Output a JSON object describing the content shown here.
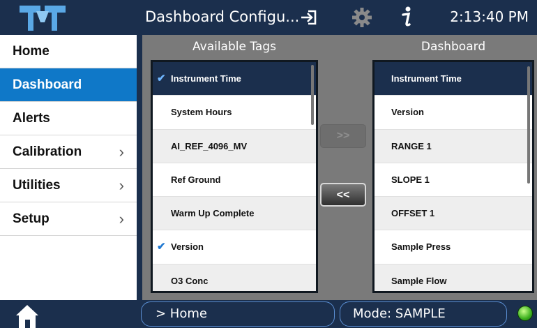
{
  "header": {
    "title": "Dashboard Configu...",
    "clock": "2:13:40 PM",
    "icons": {
      "logo": "teledyne-logo-icon",
      "exit": "exit-icon",
      "settings": "gear-icon",
      "info": "info-icon"
    }
  },
  "sidebar": {
    "items": [
      {
        "label": "Home",
        "chevron": "",
        "active": false
      },
      {
        "label": "Dashboard",
        "chevron": "",
        "active": true
      },
      {
        "label": "Alerts",
        "chevron": "",
        "active": false
      },
      {
        "label": "Calibration",
        "chevron": "›",
        "active": false
      },
      {
        "label": "Utilities",
        "chevron": "›",
        "active": false
      },
      {
        "label": "Setup",
        "chevron": "›",
        "active": false
      }
    ]
  },
  "main": {
    "available_heading": "Available Tags",
    "dashboard_heading": "Dashboard",
    "available_tags": [
      {
        "label": "Instrument Time",
        "checked": true
      },
      {
        "label": "System Hours",
        "checked": false
      },
      {
        "label": "AI_REF_4096_MV",
        "checked": false
      },
      {
        "label": "Ref Ground",
        "checked": false
      },
      {
        "label": "Warm Up Complete",
        "checked": false
      },
      {
        "label": "Version",
        "checked": true
      },
      {
        "label": "O3 Conc",
        "checked": false
      }
    ],
    "dashboard_tags": [
      "Instrument Time",
      "Version",
      "RANGE 1",
      "SLOPE 1",
      "OFFSET 1",
      "Sample Press",
      "Sample Flow"
    ],
    "add_button": ">>",
    "remove_button": "<<",
    "check_mark": "✔"
  },
  "footer": {
    "breadcrumb": "> Home",
    "mode": "Mode: SAMPLE",
    "status_color": "#3cb01e"
  },
  "colors": {
    "navy": "#1b2f4d",
    "accent": "#0f78c8"
  }
}
